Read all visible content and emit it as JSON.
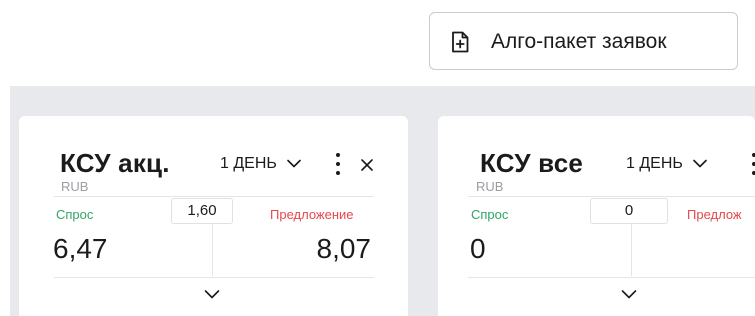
{
  "toolbar": {
    "algo_button_label": "Алго-пакет заявок",
    "algo_button_icon": "file-plus-icon"
  },
  "cards": [
    {
      "title": "КСУ акц.",
      "currency": "RUB",
      "period": "1 ДЕНЬ",
      "bid_label": "Спрос",
      "ask_label": "Предложение",
      "spread": "1,60",
      "bid_value": "6,47",
      "ask_value": "8,07"
    },
    {
      "title": "КСУ все",
      "currency": "RUB",
      "period": "1 ДЕНЬ",
      "bid_label": "Спрос",
      "ask_label": "Предлож",
      "spread": "0",
      "bid_value": "0",
      "ask_value": ""
    }
  ],
  "colors": {
    "bid": "#2ea664",
    "ask": "#e5484d",
    "workspace_bg": "#e7e9ed",
    "muted": "#9a9da3"
  }
}
